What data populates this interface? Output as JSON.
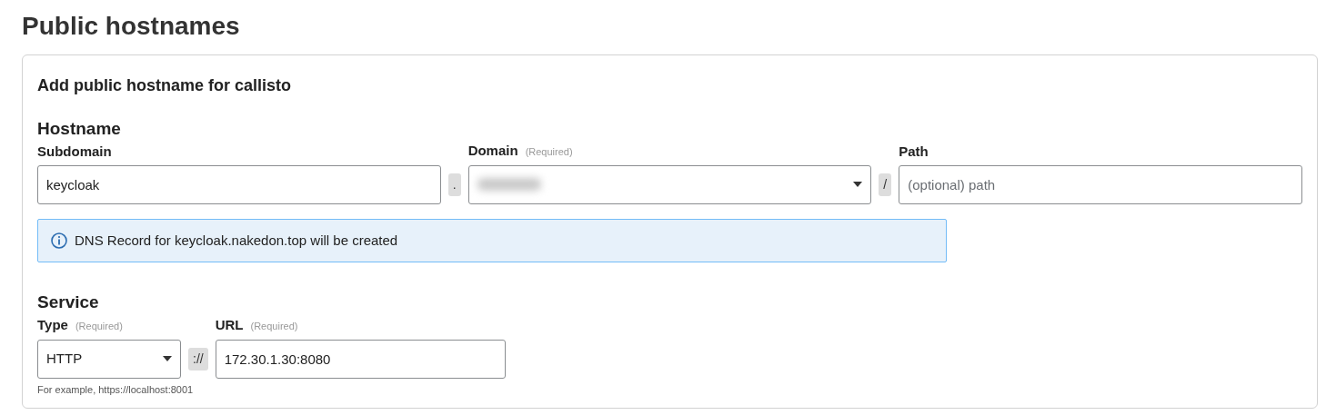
{
  "page_title": "Public hostnames",
  "card": {
    "title": "Add public hostname for callisto",
    "hostname": {
      "heading": "Hostname",
      "fields": [
        {
          "kind": "input",
          "label": "Subdomain",
          "value": "keycloak"
        },
        {
          "kind": "separator",
          "text": "."
        },
        {
          "kind": "select",
          "label": "Domain",
          "hint": "(Required)",
          "redacted": true
        },
        {
          "kind": "separator",
          "text": "/"
        },
        {
          "kind": "input",
          "label": "Path",
          "placeholder": "(optional) path"
        }
      ],
      "alert": {
        "text": "DNS Record for keycloak.nakedon.top will be created"
      }
    },
    "service": {
      "heading": "Service",
      "fields": [
        {
          "kind": "select",
          "label": "Type",
          "hint": "(Required)",
          "value": "HTTP"
        },
        {
          "kind": "separator",
          "text": "://"
        },
        {
          "kind": "input",
          "label": "URL",
          "hint": "(Required)",
          "value": "172.30.1.30:8080"
        }
      ],
      "help": "For example, https://localhost:8001"
    }
  }
}
